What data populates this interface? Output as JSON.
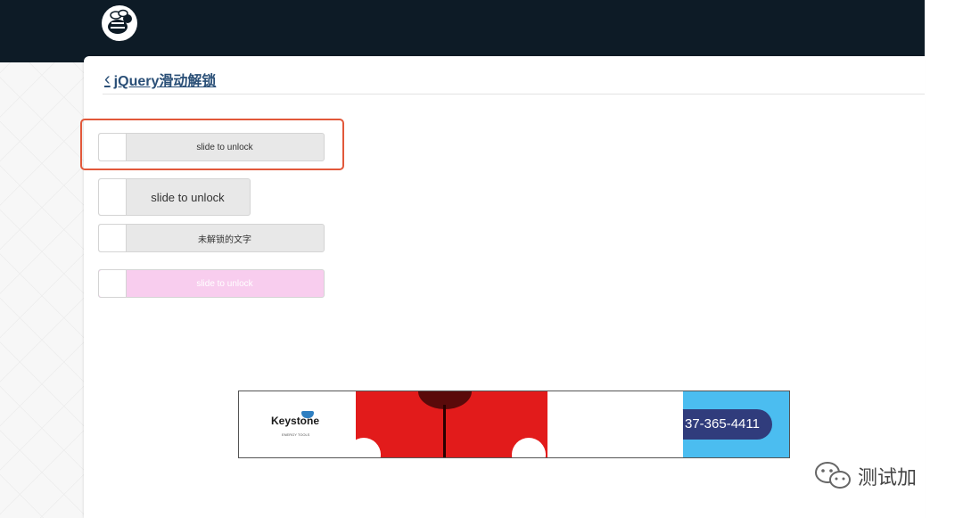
{
  "header": {
    "logo_icon": "bee-logo-icon"
  },
  "page": {
    "back_icon": "chevron-left-icon",
    "back_text": "jQuery滑动解锁"
  },
  "sliders": [
    {
      "label": "slide to unlock"
    },
    {
      "label": "slide to unlock"
    },
    {
      "label": "未解锁的文字"
    },
    {
      "label": "slide to unlock"
    }
  ],
  "colors": {
    "topbar": "#0d1b26",
    "highlight": "#e2583a",
    "slider_bg": "#e8e8e8",
    "slider_pink": "#f8cdee",
    "link": "#2a4f77"
  },
  "ad": {
    "brand": "Keystone",
    "brand_sub": "ENERGY TOOLS",
    "phone": "37-365-4411"
  },
  "watermark": {
    "icon": "wechat-icon",
    "text": "测试加"
  }
}
